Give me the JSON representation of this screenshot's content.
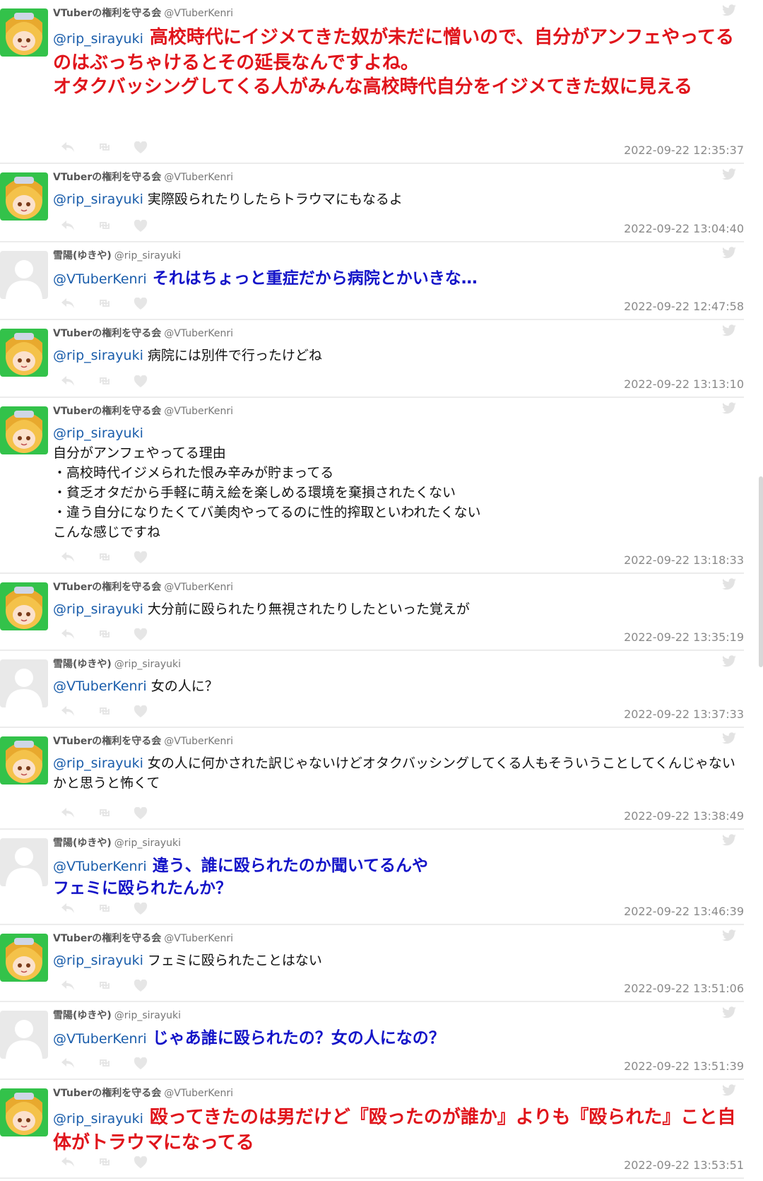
{
  "tweets": [
    {
      "user": "VTuberの権利を守る会",
      "handle": "@VTuberKenri",
      "avatar": "anime",
      "mention": "@rip_sirayuki",
      "style": "red",
      "lines": [
        "高校時代にイジメてきた奴が未だに憎いので、自分がアンフェやってるのはぶっちゃけるとその延長なんですよね。",
        "オタクバッシングしてくる人がみんな高校時代自分をイジメてきた奴に見える"
      ],
      "time": "2022-09-22 12:35:37"
    },
    {
      "user": "VTuberの権利を守る会",
      "handle": "@VTuberKenri",
      "avatar": "anime",
      "mention": "@rip_sirayuki",
      "style": "normal",
      "lines": [
        "実際殴られたりしたらトラウマにもなるよ"
      ],
      "time": "2022-09-22 13:04:40"
    },
    {
      "user": "雪陽(ゆきや)",
      "handle": "@rip_sirayuki",
      "avatar": "blank",
      "mention": "@VTuberKenri",
      "style": "blue",
      "lines": [
        "それはちょっと重症だから病院とかいきな…"
      ],
      "time": "2022-09-22 12:47:58"
    },
    {
      "user": "VTuberの権利を守る会",
      "handle": "@VTuberKenri",
      "avatar": "anime",
      "mention": "@rip_sirayuki",
      "style": "normal",
      "lines": [
        "病院には別件で行ったけどね"
      ],
      "time": "2022-09-22 13:13:10"
    },
    {
      "user": "VTuberの権利を守る会",
      "handle": "@VTuberKenri",
      "avatar": "anime",
      "mention": "@rip_sirayuki",
      "style": "normal",
      "mention_own_line": true,
      "lines": [
        "自分がアンフェやってる理由",
        "・高校時代イジメられた恨み辛みが貯まってる",
        "・貧乏オタだから手軽に萌え絵を楽しめる環境を棄損されたくない",
        "・違う自分になりたくてバ美肉やってるのに性的搾取といわれたくない",
        "こんな感じですね"
      ],
      "time": "2022-09-22 13:18:33"
    },
    {
      "user": "VTuberの権利を守る会",
      "handle": "@VTuberKenri",
      "avatar": "anime",
      "mention": "@rip_sirayuki",
      "style": "normal",
      "lines": [
        "大分前に殴られたり無視されたりしたといった覚えが"
      ],
      "time": "2022-09-22 13:35:19"
    },
    {
      "user": "雪陽(ゆきや)",
      "handle": "@rip_sirayuki",
      "avatar": "blank",
      "mention": "@VTuberKenri",
      "style": "normal",
      "lines": [
        "女の人に？"
      ],
      "time": "2022-09-22 13:37:33"
    },
    {
      "user": "VTuberの権利を守る会",
      "handle": "@VTuberKenri",
      "avatar": "anime",
      "mention": "@rip_sirayuki",
      "style": "normal",
      "lines": [
        "女の人に何かされた訳じゃないけどオタクバッシングしてくる人もそういうことしてくんじゃないかと思うと怖くて"
      ],
      "time": "2022-09-22 13:38:49"
    },
    {
      "user": "雪陽(ゆきや)",
      "handle": "@rip_sirayuki",
      "avatar": "blank",
      "mention": "@VTuberKenri",
      "style": "blue",
      "lines": [
        "違う、誰に殴られたのか聞いてるんや",
        "フェミに殴られたんか？"
      ],
      "time": "2022-09-22 13:46:39"
    },
    {
      "user": "VTuberの権利を守る会",
      "handle": "@VTuberKenri",
      "avatar": "anime",
      "mention": "@rip_sirayuki",
      "style": "normal",
      "lines": [
        "フェミに殴られたことはない"
      ],
      "time": "2022-09-22 13:51:06"
    },
    {
      "user": "雪陽(ゆきや)",
      "handle": "@rip_sirayuki",
      "avatar": "blank",
      "mention": "@VTuberKenri",
      "style": "blue",
      "lines": [
        "じゃあ誰に殴られたの？女の人になの？"
      ],
      "time": "2022-09-22 13:51:39"
    },
    {
      "user": "VTuberの権利を守る会",
      "handle": "@VTuberKenri",
      "avatar": "anime",
      "mention": "@rip_sirayuki",
      "style": "red",
      "lines": [
        "殴ってきたのは男だけど『殴ったのが誰か』よりも『殴られた』こと自体がトラウマになってる"
      ],
      "time": "2022-09-22 13:53:51"
    }
  ],
  "colors": {
    "mention": "#1a5dab",
    "red_text": "#e0141b",
    "blue_text": "#1414c8",
    "timestamp": "#8a8a8a",
    "divider": "#ececec"
  },
  "icons": [
    "twitter-bird-icon",
    "reply-icon",
    "retweet-icon",
    "like-icon"
  ]
}
